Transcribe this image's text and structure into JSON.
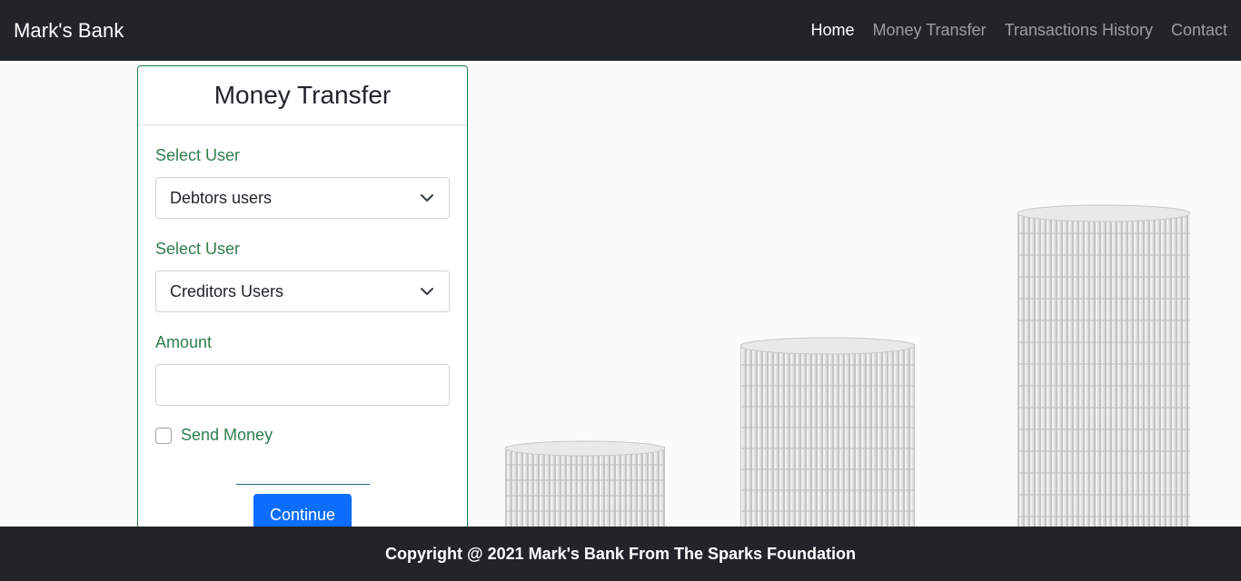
{
  "navbar": {
    "brand": "Mark's Bank",
    "links": [
      {
        "label": "Home",
        "active": true
      },
      {
        "label": "Money Transfer",
        "active": false
      },
      {
        "label": "Transactions History",
        "active": false
      },
      {
        "label": "Contact",
        "active": false
      }
    ]
  },
  "card": {
    "title": "Money Transfer",
    "debtor": {
      "label": "Select User",
      "selected": "Debtors users"
    },
    "creditor": {
      "label": "Select User",
      "selected": "Creditors Users"
    },
    "amount": {
      "label": "Amount",
      "value": ""
    },
    "send_money": {
      "label": "Send Money",
      "checked": false
    },
    "continue_label": "Continue"
  },
  "footer": {
    "text": "Copyright @ 2021 Mark's Bank From The Sparks Foundation"
  },
  "colors": {
    "navbar_bg": "#212529",
    "label_green": "#2f7d4f",
    "button_blue": "#0d6efd"
  }
}
